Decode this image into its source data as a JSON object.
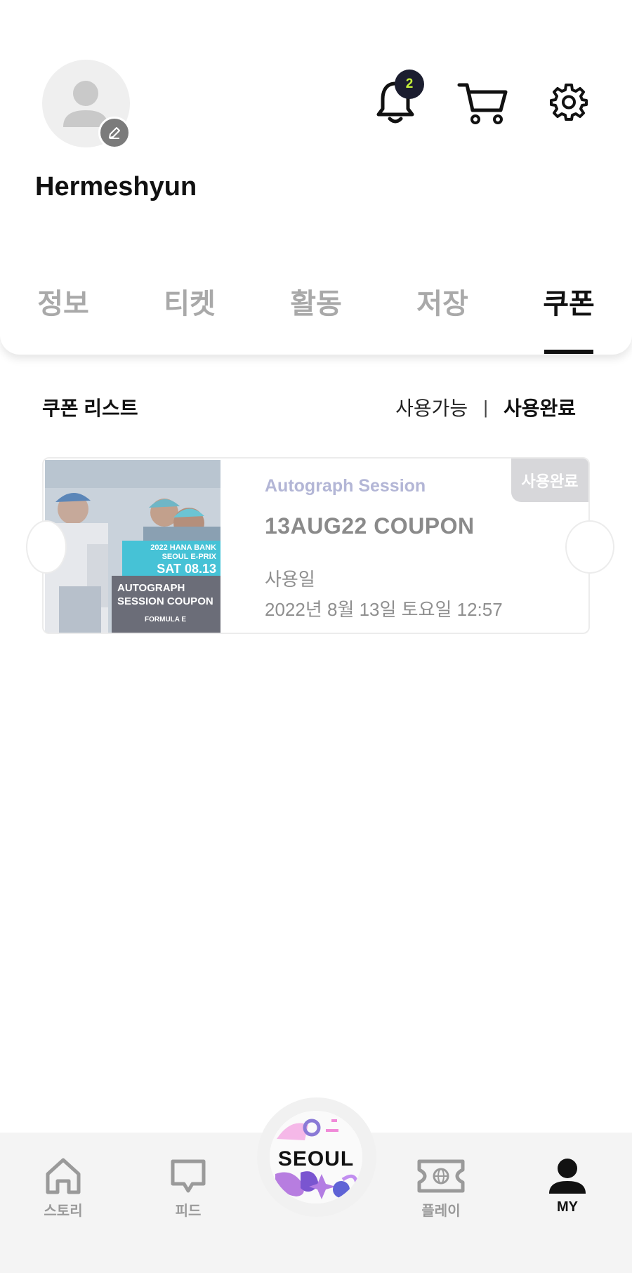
{
  "profile": {
    "username": "Hermeshyun",
    "notification_count": "2"
  },
  "tabs": [
    {
      "label": "정보",
      "active": false
    },
    {
      "label": "티켓",
      "active": false
    },
    {
      "label": "활동",
      "active": false
    },
    {
      "label": "저장",
      "active": false
    },
    {
      "label": "쿠폰",
      "active": true
    }
  ],
  "coupon_list": {
    "title": "쿠폰 리스트",
    "filter_available": "사용가능",
    "filter_separator": "|",
    "filter_used": "사용완료",
    "active_filter": "사용완료"
  },
  "coupons": [
    {
      "category": "Autograph Session",
      "title": "13AUG22 COUPON",
      "used_label": "사용일",
      "used_date": "2022년 8월 13일 토요일 12:57",
      "badge": "사용완료",
      "image": {
        "line1": "2022 HANA BANK",
        "line2": "SEOUL E-PRIX",
        "line3": "SAT 08.13",
        "line4": "AUTOGRAPH",
        "line5": "SESSION COUPON",
        "brand": "FORMULA E"
      }
    }
  ],
  "bottom_nav": {
    "items": [
      {
        "label": "스토리",
        "icon": "home-icon",
        "active": false
      },
      {
        "label": "피드",
        "icon": "chat-bubble-icon",
        "active": false
      },
      {
        "label": "플레이",
        "icon": "ticket-globe-icon",
        "active": false
      },
      {
        "label": "MY",
        "icon": "person-icon",
        "active": true
      }
    ],
    "center_logo_text": "SEOUL"
  },
  "colors": {
    "badge_bg": "#1c1e30",
    "badge_text": "#c7f23a",
    "inactive_tab": "#a9a9a9",
    "active": "#111111",
    "coupon_category": "#b3b6d6"
  }
}
